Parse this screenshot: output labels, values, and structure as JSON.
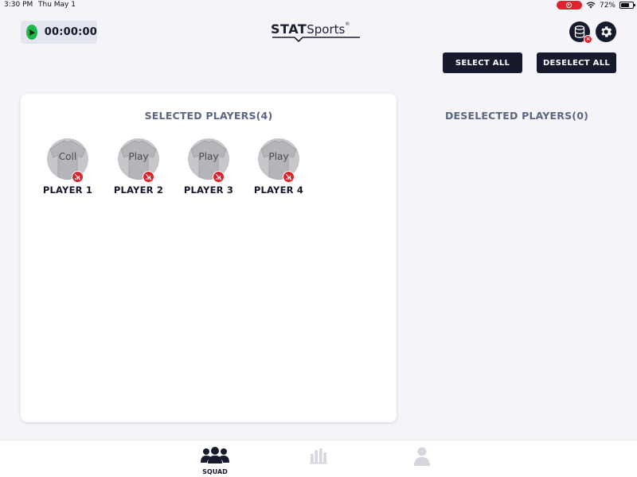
{
  "status_bar": {
    "time": "3:30 PM",
    "date": "Thu May 1",
    "battery": "72%",
    "battery_level": 0.72
  },
  "timer": {
    "value": "00:00:00"
  },
  "brand": {
    "logo_bold": "STAT",
    "logo_regular": "Sports",
    "logo_mark": "®"
  },
  "actions": {
    "select_all": "SELECT ALL",
    "deselect_all": "DESELECT ALL"
  },
  "selected": {
    "title": "SELECTED PLAYERS(4)",
    "players": [
      {
        "avatar_text": "Coll",
        "name": "PLAYER 1"
      },
      {
        "avatar_text": "Play",
        "name": "PLAYER 2"
      },
      {
        "avatar_text": "Play",
        "name": "PLAYER 3"
      },
      {
        "avatar_text": "Play",
        "name": "PLAYER 4"
      }
    ]
  },
  "deselected": {
    "title": "DESELECTED PLAYERS(0)"
  },
  "nav": {
    "squad_label": "SQUAD",
    "icons": [
      "squad-icon",
      "stats-icon",
      "profile-icon"
    ]
  },
  "colors": {
    "dark": "#161a2c",
    "accent_green": "#1fb74a",
    "alert_red": "#e0242f",
    "title_gray": "#5c6682"
  }
}
